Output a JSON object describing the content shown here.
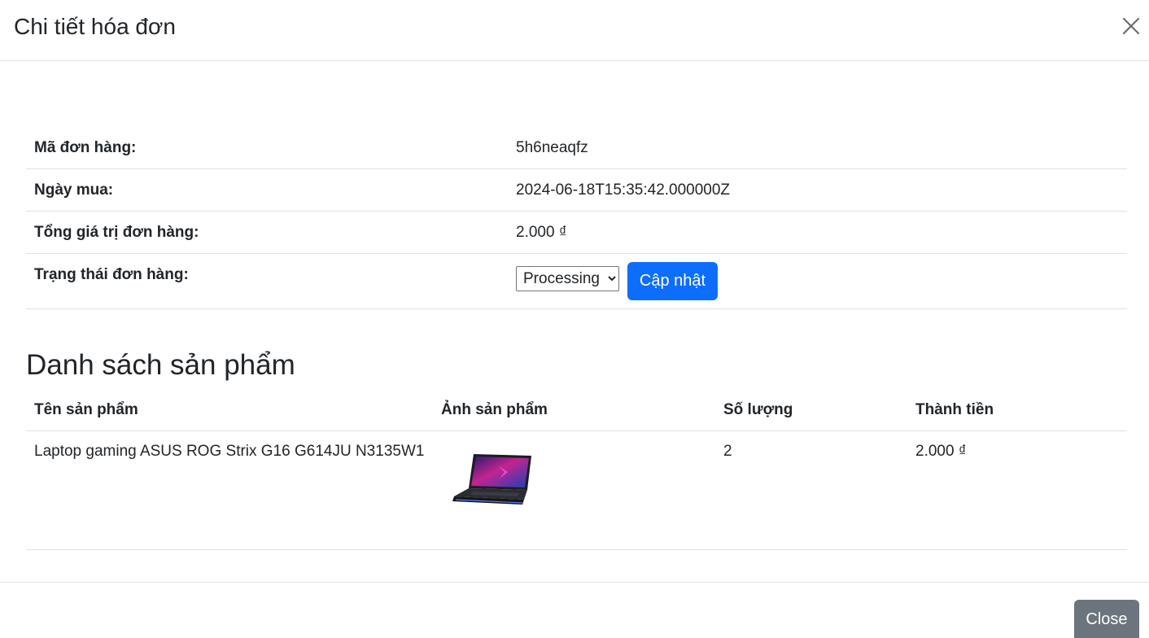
{
  "modal": {
    "title": "Chi tiết hóa đơn",
    "close_icon": "close-icon"
  },
  "order_info": {
    "order_id_label": "Mã đơn hàng:",
    "order_id_value": "5h6neaqfz",
    "date_label": "Ngày mua:",
    "date_value": "2024-06-18T15:35:42.000000Z",
    "total_label": "Tổng giá trị đơn hàng:",
    "total_value": "2.000 ₫",
    "status_label": "Trạng thái đơn hàng:",
    "status_selected": "Processing",
    "update_button": "Cập nhật"
  },
  "products": {
    "section_title": "Danh sách sản phẩm",
    "headers": [
      "Tên sản phẩm",
      "Ảnh sản phẩm",
      "Số lượng",
      "Thành tiền"
    ],
    "rows": [
      {
        "name": "Laptop gaming ASUS ROG Strix G16 G614JU N3135W1",
        "image": "laptop-product-image",
        "quantity": "2",
        "amount": "2.000 ₫"
      }
    ]
  },
  "footer": {
    "close_button": "Close"
  },
  "colors": {
    "primary": "#0d6efd",
    "secondary": "#6c757d",
    "border": "#dee2e6"
  }
}
